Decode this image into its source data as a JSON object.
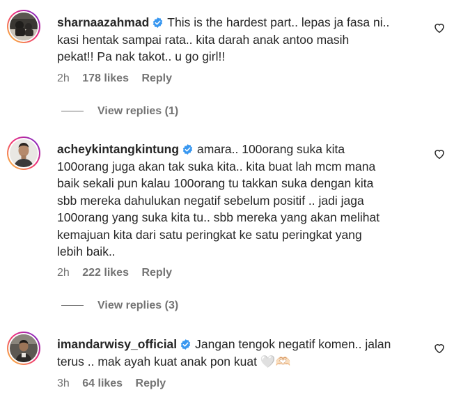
{
  "colors": {
    "text_primary": "#262626",
    "text_secondary": "#737373",
    "verified_blue": "#3897f0"
  },
  "comments": [
    {
      "username": "sharnaazahmad",
      "verified": true,
      "text_lines": [
        "This is the hardest part.. lepas ja fasa ni..",
        "kasi hentak sampai rata.. kita darah anak antoo masih",
        "pekat!! Pa nak takot.. u go girl!!"
      ],
      "time": "2h",
      "likes": "178 likes",
      "reply": "Reply",
      "view_replies": "View replies (1)",
      "avatar_icon": "avatar-photo-dark-scene"
    },
    {
      "username": "acheykintangkintung",
      "verified": true,
      "text_lines": [
        "amara.. 100orang suka kita",
        "100orang juga akan tak suka kita.. kita buat lah mcm mana",
        "baik sekali pun kalau 100orang tu takkan suka dengan kita",
        "sbb mereka dahulukan negatif sebelum positif .. jadi jaga",
        "100orang yang suka kita tu.. sbb mereka yang akan melihat",
        "kemajuan kita dari satu peringkat ke satu peringkat yang",
        "lebih baik.."
      ],
      "time": "2h",
      "likes": "222 likes",
      "reply": "Reply",
      "view_replies": "View replies (3)",
      "avatar_icon": "avatar-photo-man-portrait"
    },
    {
      "username": "imandarwisy_official",
      "verified": true,
      "text_lines": [
        "Jangan tengok negatif komen.. jalan",
        "terus .. mak ayah kuat anak pon kuat 🤍🫶🏻"
      ],
      "time": "3h",
      "likes": "64 likes",
      "reply": "Reply",
      "avatar_icon": "avatar-photo-man-dark"
    }
  ]
}
